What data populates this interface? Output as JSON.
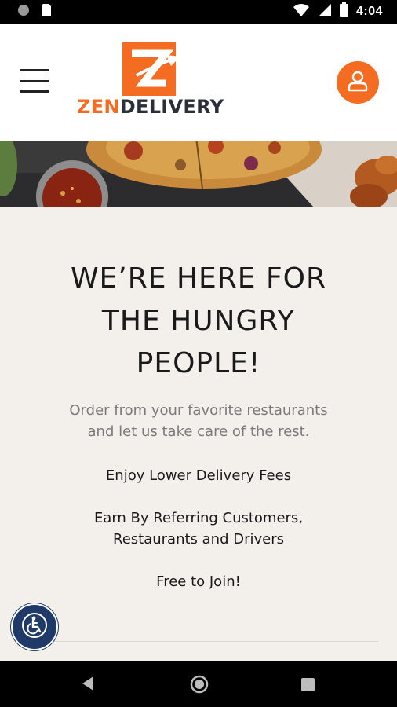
{
  "status_bar": {
    "time": "4:04"
  },
  "header": {
    "logo_part1": "ZEN",
    "logo_part2": "DELIVERY"
  },
  "content": {
    "headline_line1": "WE’RE HERE FOR",
    "headline_line2": "THE HUNGRY",
    "headline_line3": "PEOPLE!",
    "subtext_line1": "Order from your favorite restaurants",
    "subtext_line2": "and let us take care of the rest.",
    "feature1": "Enjoy Lower Delivery Fees",
    "feature2_line1": "Earn By Referring Customers,",
    "feature2_line2": "Restaurants and Drivers",
    "feature3": "Free to Join!"
  },
  "colors": {
    "brand_orange": "#f36c21",
    "brand_dark": "#2b2f3a",
    "accessibility_blue": "#1f3a68"
  }
}
